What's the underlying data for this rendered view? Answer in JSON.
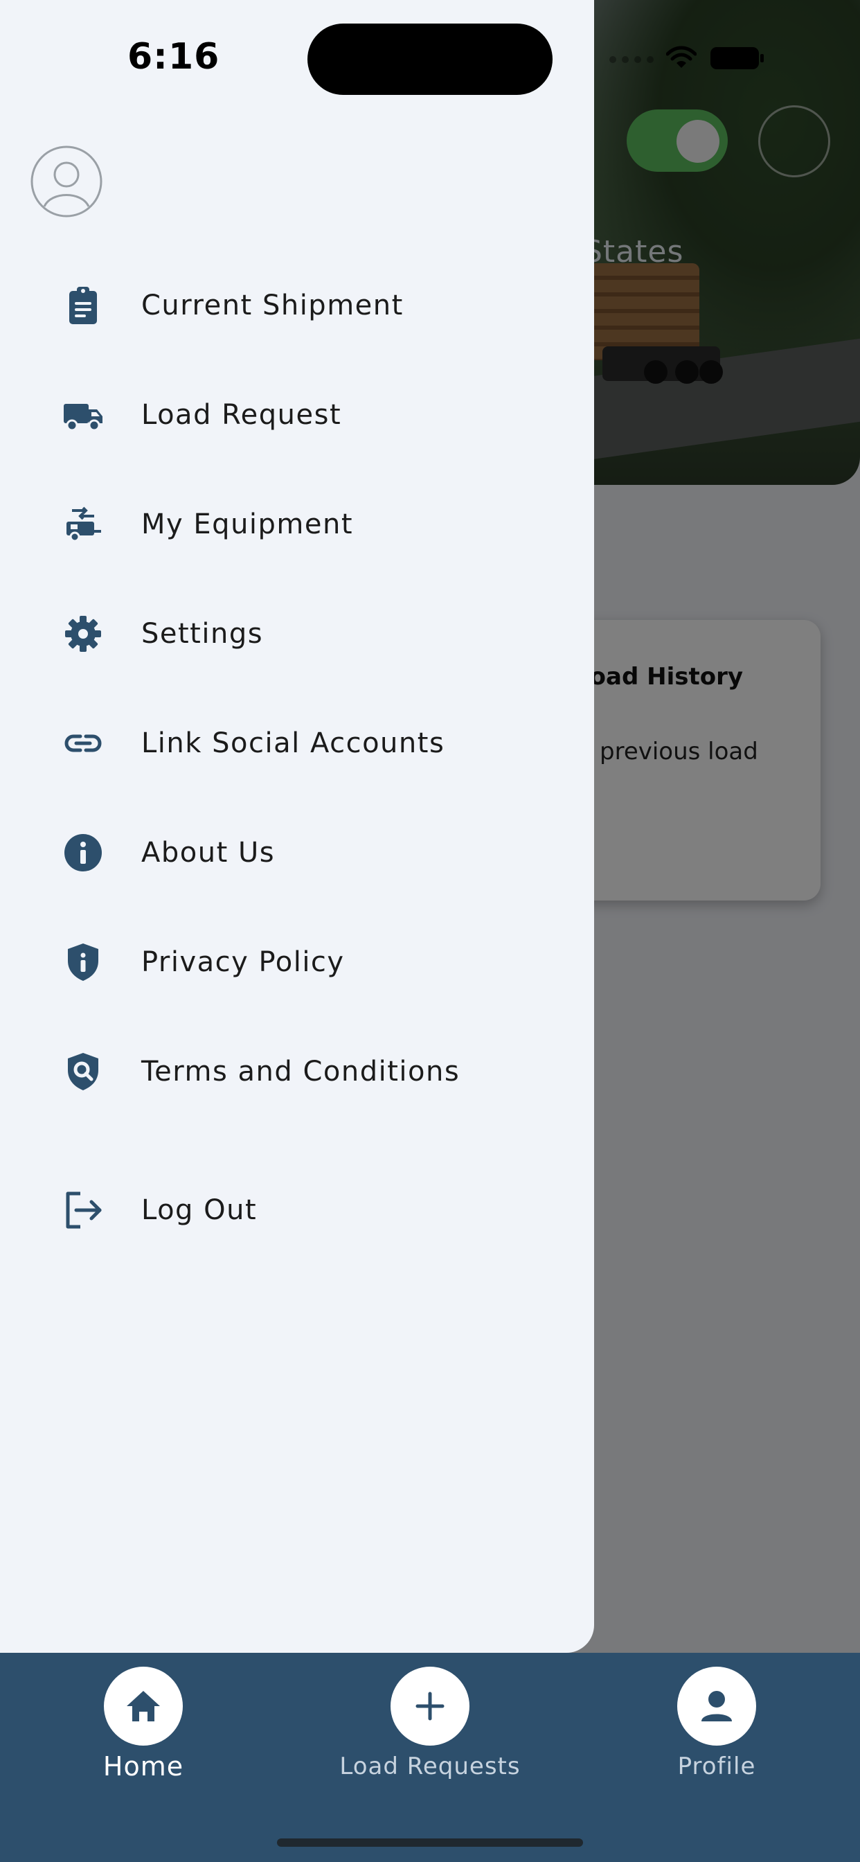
{
  "status_bar": {
    "time": "6:16",
    "icons": [
      "cellular-dots-icon",
      "wifi-icon",
      "battery-icon"
    ]
  },
  "background_screen": {
    "hero_text_fragment": "States",
    "availability_toggle_on": true,
    "card": {
      "title_fragment": "Load History",
      "text_fragment": "previous load"
    }
  },
  "drawer": {
    "avatar_icon": "user-circle-icon",
    "menu": [
      {
        "label": "Current Shipment",
        "icon": "clipboard-icon"
      },
      {
        "label": "Load Request",
        "icon": "truck-icon"
      },
      {
        "label": "My Equipment",
        "icon": "rv-trailer-icon"
      },
      {
        "label": "Settings",
        "icon": "gear-icon"
      },
      {
        "label": "Link Social Accounts",
        "icon": "link-icon"
      },
      {
        "label": "About Us",
        "icon": "info-icon"
      },
      {
        "label": "Privacy Policy",
        "icon": "shield-info-icon"
      },
      {
        "label": "Terms and Conditions",
        "icon": "shield-search-icon"
      },
      {
        "label": "Log Out",
        "icon": "logout-icon"
      }
    ]
  },
  "bottom_nav": {
    "tabs": [
      {
        "label": "Home",
        "icon": "home-icon",
        "active": true
      },
      {
        "label": "Load Requests",
        "icon": "plus-icon",
        "active": false
      },
      {
        "label": "Profile",
        "icon": "person-icon",
        "active": false
      }
    ]
  },
  "colors": {
    "drawer_bg": "#f1f4f9",
    "icon": "#2d4f6c",
    "nav_bg": "#2d4f6c",
    "toggle_on": "#5cbf5f"
  }
}
